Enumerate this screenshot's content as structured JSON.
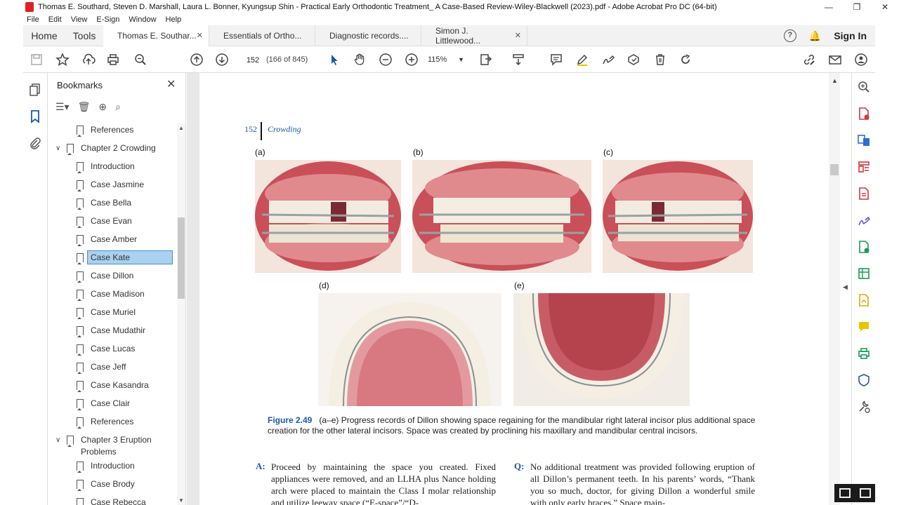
{
  "window": {
    "title": "Thomas E. Southard, Steven D. Marshall, Laura L. Bonner, Kyungsup Shin - Practical Early Orthodontic Treatment_ A Case-Based Review-Wiley-Blackwell (2023).pdf - Adobe Acrobat Pro DC (64-bit)",
    "minimize": "—",
    "restore": "❐",
    "close": "✕"
  },
  "menu": [
    "File",
    "Edit",
    "View",
    "E-Sign",
    "Window",
    "Help"
  ],
  "tabs": {
    "home": "Home",
    "tools": "Tools",
    "docs": [
      {
        "label": "Thomas E. Southar...",
        "active": true,
        "closable": true
      },
      {
        "label": "Essentials of Ortho...",
        "active": false,
        "closable": false
      },
      {
        "label": "Diagnostic records....",
        "active": false,
        "closable": false
      },
      {
        "label": "Simon J. Littlewood...",
        "active": false,
        "closable": true
      }
    ],
    "help": "?",
    "sign_in": "Sign In"
  },
  "toolbar": {
    "page_current": "152",
    "page_count": "(166 of 845)",
    "zoom": "115%"
  },
  "bookmarks": {
    "header": "Bookmarks",
    "items": [
      {
        "label": "References",
        "level": 1,
        "chevron": ""
      },
      {
        "label": "Chapter 2 Crowding",
        "level": 0,
        "chevron": "∨"
      },
      {
        "label": "Introduction",
        "level": 1,
        "chevron": ""
      },
      {
        "label": "Case Jasmine",
        "level": 1,
        "chevron": ""
      },
      {
        "label": "Case Bella",
        "level": 1,
        "chevron": ""
      },
      {
        "label": "Case Evan",
        "level": 1,
        "chevron": ""
      },
      {
        "label": "Case Amber",
        "level": 1,
        "chevron": ""
      },
      {
        "label": "Case Kate",
        "level": 1,
        "chevron": "",
        "selected": true
      },
      {
        "label": "Case Dillon",
        "level": 1,
        "chevron": ""
      },
      {
        "label": "Case Madison",
        "level": 1,
        "chevron": ""
      },
      {
        "label": "Case Muriel",
        "level": 1,
        "chevron": ""
      },
      {
        "label": "Case Mudathir",
        "level": 1,
        "chevron": ""
      },
      {
        "label": "Case Lucas",
        "level": 1,
        "chevron": ""
      },
      {
        "label": "Case Jeff",
        "level": 1,
        "chevron": ""
      },
      {
        "label": "Case Kasandra",
        "level": 1,
        "chevron": ""
      },
      {
        "label": "Case Clair",
        "level": 1,
        "chevron": ""
      },
      {
        "label": "References",
        "level": 1,
        "chevron": ""
      },
      {
        "label": "Chapter 3 Eruption",
        "label2": "Problems",
        "level": 0,
        "chevron": "∨"
      },
      {
        "label": "Introduction",
        "level": 1,
        "chevron": ""
      },
      {
        "label": "Case Brody",
        "level": 1,
        "chevron": ""
      },
      {
        "label": "Case Rebecca",
        "level": 1,
        "chevron": ""
      }
    ]
  },
  "page": {
    "number": "152",
    "section": "Crowding",
    "panels": [
      "(a)",
      "(b)",
      "(c)",
      "(d)",
      "(e)"
    ],
    "figure_label": "Figure 2.49",
    "figure_caption": "(a–e) Progress records of Dillon showing space regaining for the mandibular right lateral incisor plus additional space creation for the other lateral incisors. Space was created by proclining his maxillary and mandibular central incisors.",
    "a_label": "A:",
    "a_text": "Proceed by maintaining the space you created. Fixed appliances were removed, and an LLHA plus Nance holding arch were placed to maintain the Class I molar relationship and utilize leeway space (“E-space”/“D-",
    "q_label": "Q:",
    "q_text": "No additional treatment was provided following eruption of all Dillon’s permanent teeth. In his parents’ words, “Thank you so much, doctor, for giving Dillon a wonderful smile with only early braces.” Space main-"
  },
  "colors": {
    "accent": "#1a5aa8",
    "selected_bg": "#a9d1f0",
    "gum": "#d9757a",
    "tooth": "#f4efe2"
  }
}
